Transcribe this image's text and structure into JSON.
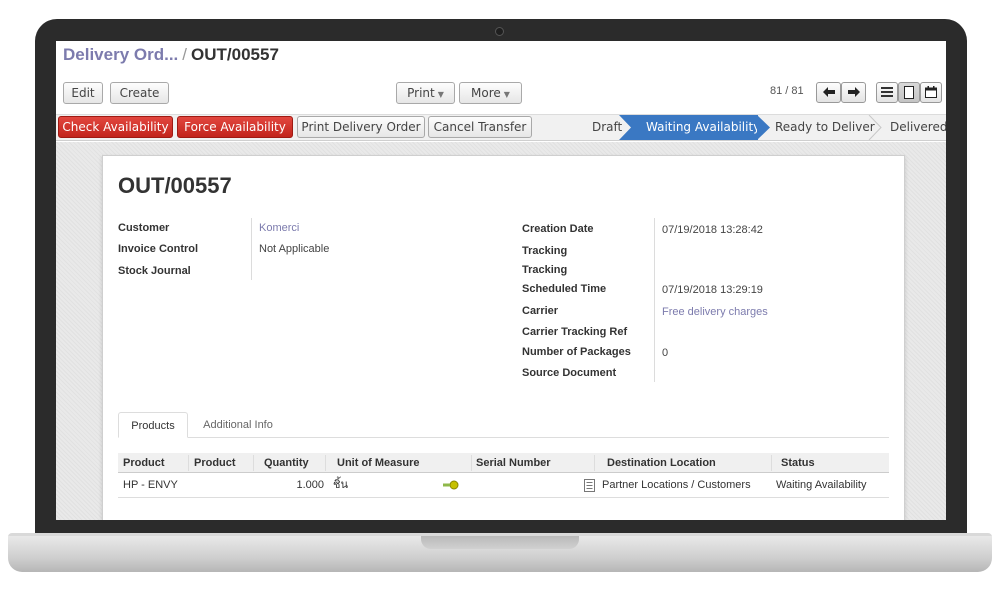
{
  "breadcrumb": {
    "parent": "Delivery Ord...",
    "separator": "/",
    "current": "OUT/00557"
  },
  "toolbar": {
    "edit": "Edit",
    "create": "Create",
    "print": "Print",
    "more": "More"
  },
  "pager": {
    "text": "81 / 81"
  },
  "actions": {
    "check_availability": "Check Availability",
    "force_availability": "Force Availability",
    "print_delivery_order": "Print Delivery Order",
    "cancel_transfer": "Cancel Transfer"
  },
  "status_stages": [
    {
      "label": "Draft",
      "active": false
    },
    {
      "label": "Waiting Availability",
      "active": true
    },
    {
      "label": "Ready to Deliver",
      "active": false
    },
    {
      "label": "Delivered",
      "active": false
    }
  ],
  "record": {
    "title": "OUT/00557",
    "left_fields": [
      {
        "label": "Customer",
        "value": "Komerci",
        "link": true
      },
      {
        "label": "Invoice Control",
        "value": "Not Applicable",
        "link": false
      },
      {
        "label": "Stock Journal",
        "value": "",
        "link": false
      }
    ],
    "right_fields": [
      {
        "label": "Creation Date",
        "value": "07/19/2018 13:28:42",
        "link": false
      },
      {
        "label": "Tracking",
        "value": "",
        "link": false
      },
      {
        "label": "Tracking",
        "value": "",
        "link": false
      },
      {
        "label": "Scheduled Time",
        "value": "07/19/2018 13:29:19",
        "link": false
      },
      {
        "label": "Carrier",
        "value": "Free delivery charges",
        "link": true
      },
      {
        "label": "Carrier Tracking Ref",
        "value": "",
        "link": false
      },
      {
        "label": "Number of Packages",
        "value": "0",
        "link": false
      },
      {
        "label": "Source Document",
        "value": "",
        "link": false
      }
    ]
  },
  "tabs": [
    {
      "label": "Products",
      "active": true
    },
    {
      "label": "Additional Info",
      "active": false
    }
  ],
  "table": {
    "headers": [
      "Product",
      "Product",
      "Quantity",
      "Unit of Measure",
      "Serial Number",
      "Destination Location",
      "Status"
    ],
    "rows": [
      {
        "product": "HP - ENVY",
        "product2": "",
        "quantity": "1.000",
        "uom": "ชิ้น",
        "serial": "",
        "destination": "Partner Locations / Customers",
        "status": "Waiting Availability"
      }
    ]
  },
  "colors": {
    "accent_blue": "#3a78c3",
    "action_red": "#d1322a",
    "link_purple": "#7c7bad",
    "search_icon_color": "#c6c000"
  },
  "icons": [
    "arrow-left-icon",
    "arrow-right-icon",
    "list-view-icon",
    "form-view-icon",
    "calendar-view-icon",
    "search-more-icon",
    "notes-icon"
  ]
}
